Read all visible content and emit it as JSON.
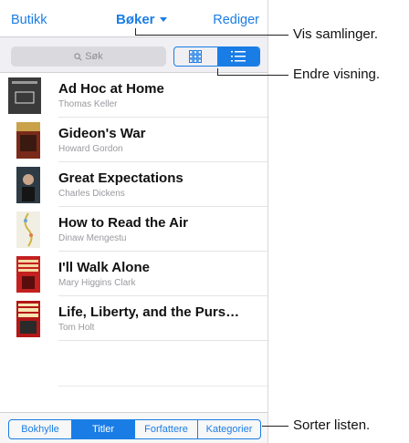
{
  "nav": {
    "left": "Butikk",
    "center": "Bøker",
    "right": "Rediger"
  },
  "search": {
    "placeholder": "Søk"
  },
  "books": [
    {
      "title": "Ad Hoc at Home",
      "author": "Thomas Keller",
      "cover_color": "#3a3a3a"
    },
    {
      "title": "Gideon's War",
      "author": "Howard Gordon",
      "cover_color": "#7a2a1a"
    },
    {
      "title": "Great Expectations",
      "author": "Charles Dickens",
      "cover_color": "#2e3a44"
    },
    {
      "title": "How to Read the Air",
      "author": "Dinaw Mengestu",
      "cover_color": "#f1efe3"
    },
    {
      "title": "I'll Walk Alone",
      "author": "Mary Higgins Clark",
      "cover_color": "#c32020"
    },
    {
      "title": "Life, Liberty, and the Purs…",
      "author": "Tom Holt",
      "cover_color": "#b31717"
    }
  ],
  "tabs": [
    "Bokhylle",
    "Titler",
    "Forfattere",
    "Kategorier"
  ],
  "active_tab": "Titler",
  "callouts": {
    "collections": "Vis samlinger.",
    "view": "Endre visning.",
    "sort": "Sorter listen."
  },
  "colors": {
    "accent": "#1a7de6"
  }
}
